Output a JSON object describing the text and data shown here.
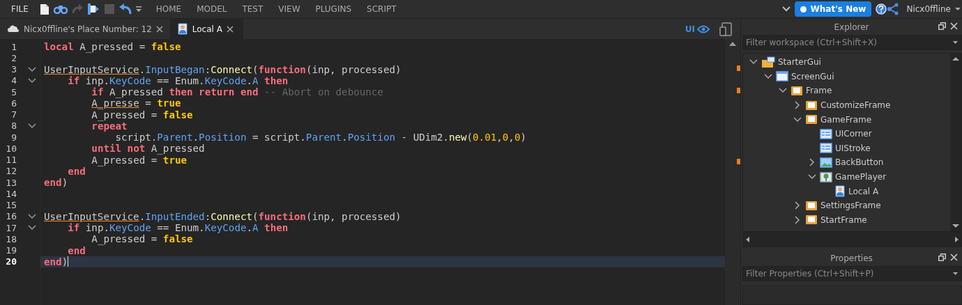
{
  "menu_bar": {
    "file": "FILE",
    "menus": [
      "HOME",
      "MODEL",
      "TEST",
      "VIEW",
      "PLUGINS",
      "SCRIPT"
    ],
    "whats_new": "What's New",
    "user": "Nicx0ffline"
  },
  "tabs": [
    {
      "label": "Nicx0ffline's Place Number: 12",
      "kind": "place",
      "selected": false
    },
    {
      "label": "Local A",
      "kind": "script",
      "selected": true
    }
  ],
  "ui_toggle": {
    "label": "UI",
    "on": true
  },
  "editor": {
    "lines": [
      {
        "number": "1",
        "foldable": false,
        "current": false,
        "tokens": [
          {
            "kind": "kw",
            "text": "local"
          },
          {
            "kind": "plain",
            "text": " A_pressed = "
          },
          {
            "kind": "bool",
            "text": "false"
          }
        ]
      },
      {
        "number": "2",
        "foldable": false,
        "current": false
      },
      {
        "number": "3",
        "foldable": true,
        "current": false,
        "tokens": [
          {
            "kind": "warn",
            "text": "UserInputService"
          },
          {
            "kind": "plain",
            "text": "."
          },
          {
            "kind": "prop",
            "text": "InputBegan"
          },
          {
            "kind": "plain",
            "text": ":"
          },
          {
            "kind": "method",
            "text": "Connect"
          },
          {
            "kind": "plain",
            "text": "("
          },
          {
            "kind": "kw",
            "text": "function"
          },
          {
            "kind": "plain",
            "text": "(inp, processed)"
          }
        ]
      },
      {
        "number": "4",
        "foldable": true,
        "current": false,
        "tokens": [
          {
            "kind": "kw",
            "text": "    if"
          },
          {
            "kind": "plain",
            "text": " inp."
          },
          {
            "kind": "prop",
            "text": "KeyCode"
          },
          {
            "kind": "plain",
            "text": " == Enum."
          },
          {
            "kind": "prop",
            "text": "KeyCode"
          },
          {
            "kind": "plain",
            "text": "."
          },
          {
            "kind": "prop",
            "text": "A"
          },
          {
            "kind": "kw",
            "text": " then"
          }
        ]
      },
      {
        "number": "5",
        "foldable": false,
        "current": false,
        "tokens": [
          {
            "kind": "kw",
            "text": "        if"
          },
          {
            "kind": "plain",
            "text": " A_pressed "
          },
          {
            "kind": "kw",
            "text": "then return end"
          },
          {
            "kind": "comment",
            "text": " -- Abort on debounce"
          }
        ]
      },
      {
        "number": "6",
        "foldable": false,
        "current": false,
        "tokens": [
          {
            "kind": "warn",
            "text": "        A_presse"
          },
          {
            "kind": "plain",
            "text": " = "
          },
          {
            "kind": "bool",
            "text": "true"
          }
        ]
      },
      {
        "number": "7",
        "foldable": false,
        "current": false,
        "tokens": [
          {
            "kind": "plain",
            "text": "        A_pressed = "
          },
          {
            "kind": "bool",
            "text": "false"
          }
        ]
      },
      {
        "number": "8",
        "foldable": true,
        "current": false,
        "tokens": [
          {
            "kind": "kw",
            "text": "        repeat"
          }
        ]
      },
      {
        "number": "9",
        "foldable": false,
        "current": false,
        "tokens": [
          {
            "kind": "plain",
            "text": "            script."
          },
          {
            "kind": "prop",
            "text": "Parent"
          },
          {
            "kind": "plain",
            "text": "."
          },
          {
            "kind": "prop",
            "text": "Position"
          },
          {
            "kind": "plain",
            "text": " = script."
          },
          {
            "kind": "prop",
            "text": "Parent"
          },
          {
            "kind": "plain",
            "text": "."
          },
          {
            "kind": "prop",
            "text": "Position"
          },
          {
            "kind": "plain",
            "text": " - UDim2."
          },
          {
            "kind": "method",
            "text": "new"
          },
          {
            "kind": "plain",
            "text": "("
          },
          {
            "kind": "num",
            "text": "0.01"
          },
          {
            "kind": "plain",
            "text": ","
          },
          {
            "kind": "num",
            "text": "0"
          },
          {
            "kind": "plain",
            "text": ","
          },
          {
            "kind": "num",
            "text": "0"
          },
          {
            "kind": "plain",
            "text": ")"
          }
        ]
      },
      {
        "number": "10",
        "foldable": false,
        "current": false,
        "tokens": [
          {
            "kind": "kw",
            "text": "        until not"
          },
          {
            "kind": "plain",
            "text": " A_pressed"
          }
        ]
      },
      {
        "number": "11",
        "foldable": false,
        "current": false,
        "tokens": [
          {
            "kind": "plain",
            "text": "        A_pressed = "
          },
          {
            "kind": "bool",
            "text": "true"
          }
        ]
      },
      {
        "number": "12",
        "foldable": false,
        "current": false,
        "tokens": [
          {
            "kind": "kw",
            "text": "    end"
          }
        ]
      },
      {
        "number": "13",
        "foldable": false,
        "current": false,
        "tokens": [
          {
            "kind": "kw",
            "text": "end"
          },
          {
            "kind": "plain",
            "text": ")"
          }
        ]
      },
      {
        "number": "14",
        "foldable": false,
        "current": false
      },
      {
        "number": "15",
        "foldable": false,
        "current": false
      },
      {
        "number": "16",
        "foldable": true,
        "current": false,
        "tokens": [
          {
            "kind": "warn",
            "text": "UserInputService"
          },
          {
            "kind": "plain",
            "text": "."
          },
          {
            "kind": "prop",
            "text": "InputEnded"
          },
          {
            "kind": "plain",
            "text": ":"
          },
          {
            "kind": "method",
            "text": "Connect"
          },
          {
            "kind": "plain",
            "text": "("
          },
          {
            "kind": "kw",
            "text": "function"
          },
          {
            "kind": "plain",
            "text": "(inp, processed)"
          }
        ]
      },
      {
        "number": "17",
        "foldable": true,
        "current": false,
        "tokens": [
          {
            "kind": "kw",
            "text": "    if"
          },
          {
            "kind": "plain",
            "text": " inp."
          },
          {
            "kind": "prop",
            "text": "KeyCode"
          },
          {
            "kind": "plain",
            "text": " == Enum."
          },
          {
            "kind": "prop",
            "text": "KeyCode"
          },
          {
            "kind": "plain",
            "text": "."
          },
          {
            "kind": "prop",
            "text": "A"
          },
          {
            "kind": "kw",
            "text": " then"
          }
        ]
      },
      {
        "number": "18",
        "foldable": false,
        "current": false,
        "tokens": [
          {
            "kind": "plain",
            "text": "        A_pressed = "
          },
          {
            "kind": "bool",
            "text": "false"
          }
        ]
      },
      {
        "number": "19",
        "foldable": false,
        "current": false,
        "tokens": [
          {
            "kind": "kw",
            "text": "    end"
          }
        ]
      },
      {
        "number": "20",
        "foldable": false,
        "current": true,
        "tokens": [
          {
            "kind": "kw",
            "text": "end"
          },
          {
            "kind": "plain",
            "text": ")"
          }
        ]
      }
    ]
  },
  "explorer": {
    "title": "Explorer",
    "filter": {
      "placeholder": "Filter workspace (Ctrl+Shift+X)"
    },
    "tree": [
      {
        "label": "StarterGui",
        "kind": "folder",
        "expanded": true,
        "children": [
          {
            "label": "ScreenGui",
            "kind": "screen",
            "expanded": true,
            "children": [
              {
                "label": "Frame",
                "kind": "frame",
                "expanded": true,
                "children": [
                  {
                    "label": "CustomizeFrame",
                    "kind": "frame",
                    "expanded": false
                  },
                  {
                    "label": "GameFrame",
                    "kind": "frame",
                    "expanded": true,
                    "children": [
                      {
                        "label": "UICorner",
                        "kind": "component"
                      },
                      {
                        "label": "UIStroke",
                        "kind": "component"
                      },
                      {
                        "label": "BackButton",
                        "kind": "image",
                        "expanded": false
                      },
                      {
                        "label": "GamePlayer",
                        "kind": "viewport",
                        "expanded": true,
                        "children": [
                          {
                            "label": "Local A",
                            "kind": "script"
                          }
                        ]
                      }
                    ]
                  },
                  {
                    "label": "SettingsFrame",
                    "kind": "frame",
                    "expanded": false
                  },
                  {
                    "label": "StartFrame",
                    "kind": "frame",
                    "expanded": false
                  }
                ]
              }
            ]
          }
        ]
      }
    ]
  },
  "properties": {
    "title": "Properties",
    "filter": {
      "placeholder": "Filter Properties (Ctrl+Shift+P)"
    }
  }
}
